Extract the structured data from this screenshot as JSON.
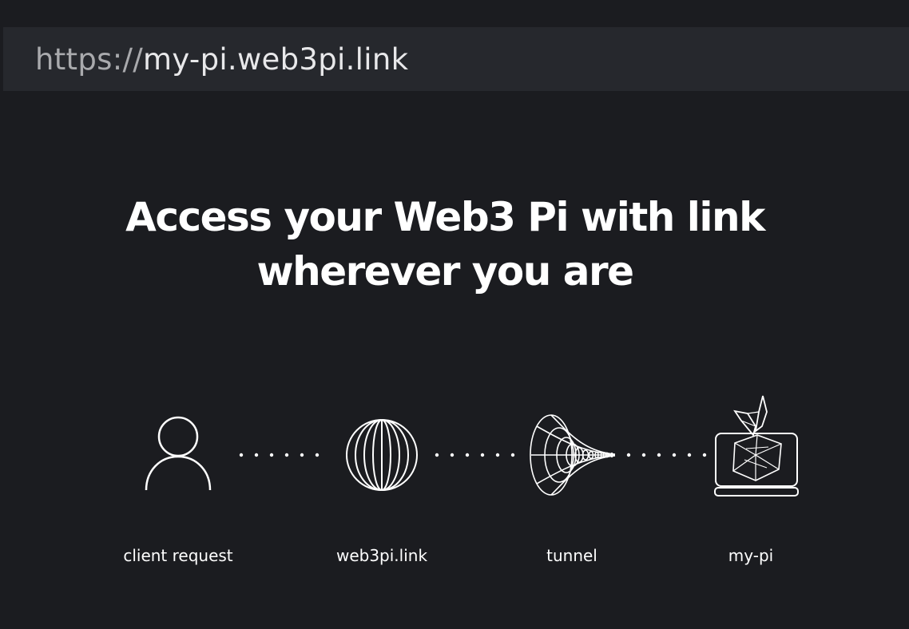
{
  "address_bar": {
    "scheme": "https://",
    "host": "my-pi.web3pi.link"
  },
  "headline": {
    "line1": "Access your Web3 Pi with link",
    "line2": "wherever you are"
  },
  "flow": {
    "steps": [
      {
        "label": "client request",
        "icon": "user-icon"
      },
      {
        "label": "web3pi.link",
        "icon": "globe-icon"
      },
      {
        "label": "tunnel",
        "icon": "wormhole-tunnel-icon"
      },
      {
        "label": "my-pi",
        "icon": "raspberry-pi-device-icon"
      }
    ]
  },
  "colors": {
    "background": "#1b1c20",
    "address_bar": "#26282d",
    "foreground": "#ffffff"
  }
}
